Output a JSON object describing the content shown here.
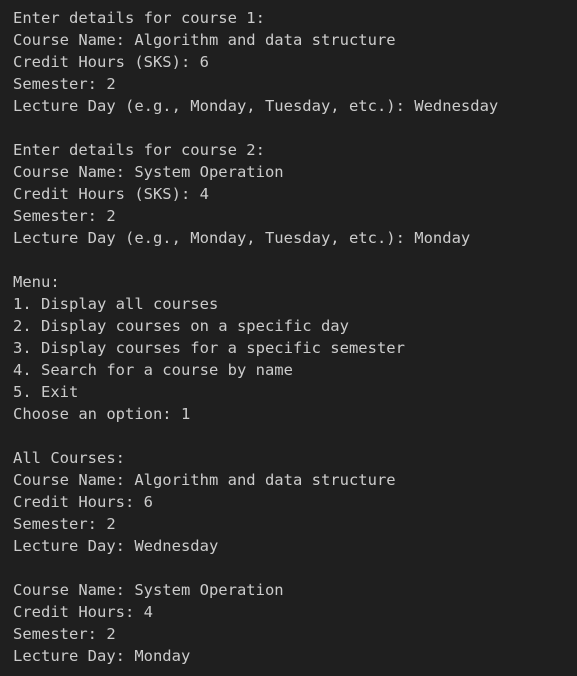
{
  "terminal": {
    "lines": [
      "Enter details for course 1:",
      "Course Name: Algorithm and data structure",
      "Credit Hours (SKS): 6",
      "Semester: 2",
      "Lecture Day (e.g., Monday, Tuesday, etc.): Wednesday",
      "",
      "Enter details for course 2:",
      "Course Name: System Operation",
      "Credit Hours (SKS): 4",
      "Semester: 2",
      "Lecture Day (e.g., Monday, Tuesday, etc.): Monday",
      "",
      "Menu:",
      "1. Display all courses",
      "2. Display courses on a specific day",
      "3. Display courses for a specific semester",
      "4. Search for a course by name",
      "5. Exit",
      "Choose an option: 1",
      "",
      "All Courses:",
      "Course Name: Algorithm and data structure",
      "Credit Hours: 6",
      "Semester: 2",
      "Lecture Day: Wednesday",
      "",
      "Course Name: System Operation",
      "Credit Hours: 4",
      "Semester: 2",
      "Lecture Day: Monday"
    ]
  },
  "colors": {
    "background": "#1f1f1f",
    "text": "#cccccc"
  }
}
